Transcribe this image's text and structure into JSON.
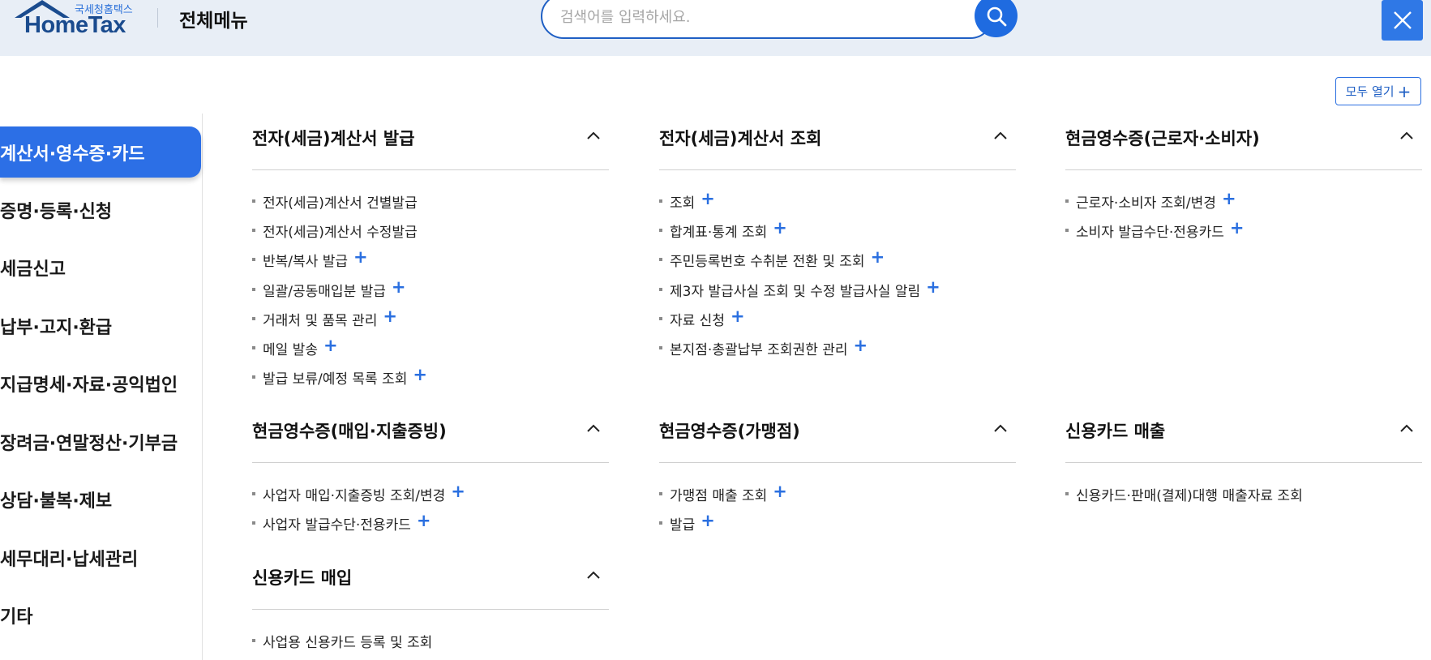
{
  "header": {
    "logo_sub": "국세청홈택스",
    "logo_main": "HomeTax",
    "title": "전체메뉴",
    "search_placeholder": "검색어를 입력하세요.",
    "search_icon": "search-icon",
    "close_icon": "close-icon"
  },
  "expand_all_label": "모두 열기",
  "sidebar": {
    "items": [
      {
        "label": "계산서·영수증·카드",
        "active": true
      },
      {
        "label": "증명·등록·신청",
        "active": false
      },
      {
        "label": "세금신고",
        "active": false
      },
      {
        "label": "납부·고지·환급",
        "active": false
      },
      {
        "label": "지급명세·자료·공익법인",
        "active": false
      },
      {
        "label": "장려금·연말정산·기부금",
        "active": false
      },
      {
        "label": "상담·불복·제보",
        "active": false
      },
      {
        "label": "세무대리·납세관리",
        "active": false
      },
      {
        "label": "기타",
        "active": false
      }
    ]
  },
  "sections": [
    {
      "title": "전자(세금)계산서 발급",
      "items": [
        {
          "label": "전자(세금)계산서 건별발급",
          "plus": false
        },
        {
          "label": "전자(세금)계산서 수정발급",
          "plus": false
        },
        {
          "label": "반복/복사 발급",
          "plus": true
        },
        {
          "label": "일괄/공동매입분 발급",
          "plus": true
        },
        {
          "label": "거래처 및 품목 관리",
          "plus": true
        },
        {
          "label": "메일 발송",
          "plus": true
        },
        {
          "label": "발급 보류/예정 목록 조회",
          "plus": true
        }
      ]
    },
    {
      "title": "전자(세금)계산서 조회",
      "items": [
        {
          "label": "조회",
          "plus": true
        },
        {
          "label": "합계표·통계 조회",
          "plus": true
        },
        {
          "label": "주민등록번호 수취분 전환 및 조회",
          "plus": true
        },
        {
          "label": "제3자 발급사실 조회 및 수정 발급사실 알림",
          "plus": true
        },
        {
          "label": "자료 신청",
          "plus": true
        },
        {
          "label": "본지점·총괄납부 조회권한 관리",
          "plus": true
        }
      ]
    },
    {
      "title": "현금영수증(근로자·소비자)",
      "items": [
        {
          "label": "근로자·소비자 조회/변경",
          "plus": true
        },
        {
          "label": "소비자 발급수단·전용카드",
          "plus": true
        }
      ]
    },
    {
      "title": "현금영수증(매입·지출증빙)",
      "items": [
        {
          "label": "사업자 매입·지출증빙 조회/변경",
          "plus": true
        },
        {
          "label": "사업자 발급수단·전용카드",
          "plus": true
        }
      ]
    },
    {
      "title": "현금영수증(가맹점)",
      "items": [
        {
          "label": "가맹점 매출 조회",
          "plus": true
        },
        {
          "label": "발급",
          "plus": true
        }
      ]
    },
    {
      "title": "신용카드 매출",
      "items": [
        {
          "label": "신용카드·판매(결제)대행 매출자료 조회",
          "plus": false
        }
      ]
    },
    {
      "title": "신용카드 매입",
      "items": [
        {
          "label": "사업용 신용카드 등록 및 조회",
          "plus": false
        }
      ]
    }
  ],
  "colors": {
    "accent": "#2c6fe6",
    "header_bg": "#e8eef6",
    "brand_navy": "#1a4b8e"
  }
}
